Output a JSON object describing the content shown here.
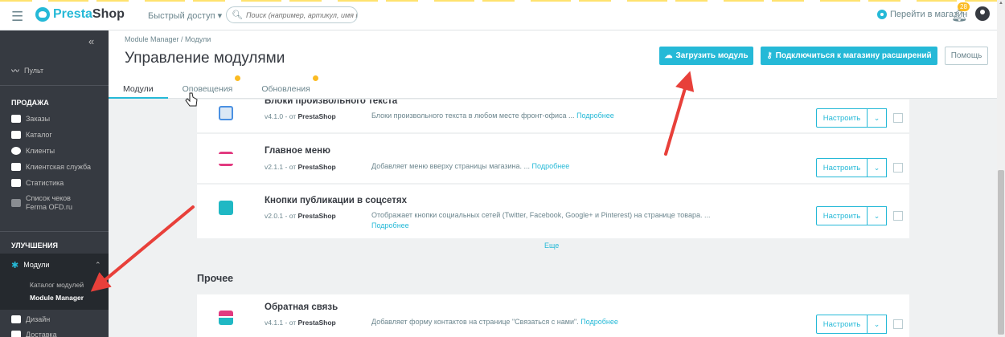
{
  "topbar": {
    "logo_text_pre": "Presta",
    "logo_text_post": "Shop",
    "quick_access": "Быстрый доступ ▾",
    "search_placeholder": "Поиск (например, артикул, имя поль:",
    "view_shop": "Перейти в магазин",
    "notif_count": "28"
  },
  "sidebar": {
    "dashboard": "Пульт",
    "section_sales": "ПРОДАЖА",
    "orders": "Заказы",
    "catalog": "Каталог",
    "customers": "Клиенты",
    "customer_service": "Клиентская служба",
    "stats": "Статистика",
    "ferma": "Список чеков Ferma OFD.ru",
    "section_improve": "УЛУЧШЕНИЯ",
    "modules": "Модули",
    "module_catalog": "Каталог модулей",
    "module_manager": "Module Manager",
    "design": "Дизайн",
    "shipping": "Доставка"
  },
  "header": {
    "breadcrumb": "Module Manager / Модули",
    "title": "Управление модулями",
    "upload_btn": "Загрузить модуль",
    "connect_btn": "Подключиться к магазину расширений",
    "help_btn": "Помощь",
    "tabs": [
      "Модули",
      "Оповещения",
      "Обновления"
    ]
  },
  "modules": [
    {
      "name": "Блоки произвольного текста",
      "version": "v4.1.0 - от ",
      "author": "PrestaShop",
      "desc": "Блоки произвольного текста в любом месте фронт-офиса ... ",
      "more": "Подробнее",
      "configure": "Настроить"
    },
    {
      "name": "Главное меню",
      "version": "v2.1.1 - от ",
      "author": "PrestaShop",
      "desc": "Добавляет меню вверху страницы магазина. ... ",
      "more": "Подробнее",
      "configure": "Настроить"
    },
    {
      "name": "Кнопки публикации в соцсетях",
      "version": "v2.0.1 - от ",
      "author": "PrestaShop",
      "desc": "Отображает кнопки социальных сетей (Twitter, Facebook, Google+ и Pinterest) на странице товара. ...",
      "more": "Подробнее",
      "configure": "Настроить"
    }
  ],
  "see_more": "Еще",
  "section_other": "Прочее",
  "other_modules": [
    {
      "name": "Обратная связь",
      "version": "v4.1.1 - от ",
      "author": "PrestaShop",
      "desc": "Добавляет форму контактов на странице \"Связаться с нами\". ",
      "more": "Подробнее",
      "configure": "Настроить"
    }
  ],
  "colors": {
    "accent": "#25b9d7",
    "sidebar_bg": "#363a41",
    "badge": "#fbbb22",
    "arrow": "#e8403a"
  }
}
